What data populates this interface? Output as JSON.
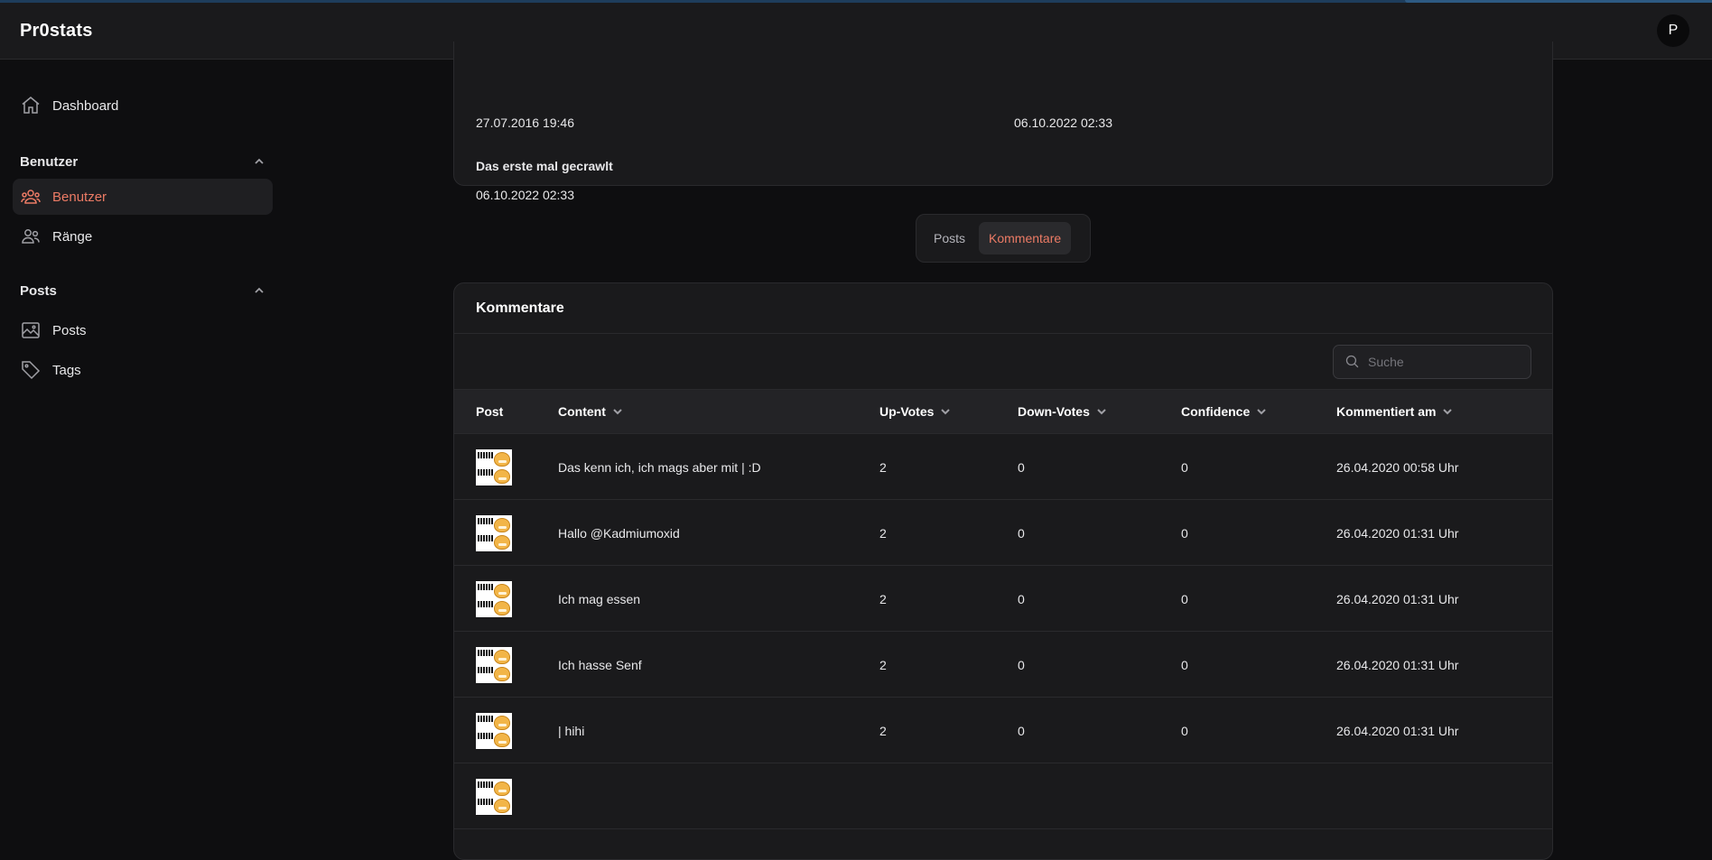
{
  "app": {
    "title": "Pr0stats",
    "user_initial": "P"
  },
  "sidebar": {
    "dashboard": "Dashboard",
    "sections": [
      {
        "title": "Benutzer",
        "items": [
          {
            "label": "Benutzer",
            "icon": "users-icon",
            "active": true
          },
          {
            "label": "Ränge",
            "icon": "user-group-icon",
            "active": false
          }
        ]
      },
      {
        "title": "Posts",
        "items": [
          {
            "label": "Posts",
            "icon": "image-icon",
            "active": false
          },
          {
            "label": "Tags",
            "icon": "tag-icon",
            "active": false
          }
        ]
      }
    ]
  },
  "info": {
    "value_left": "27.07.2016 19:46",
    "value_right": "06.10.2022 02:33",
    "crawled_label": "Das erste mal gecrawlt",
    "crawled_value": "06.10.2022 02:33"
  },
  "tabs": {
    "posts": "Posts",
    "comments": "Kommentare"
  },
  "comments": {
    "title": "Kommentare",
    "search_placeholder": "Suche",
    "columns": {
      "post": "Post",
      "content": "Content",
      "up": "Up-Votes",
      "down": "Down-Votes",
      "confidence": "Confidence",
      "date": "Kommentiert am"
    },
    "rows": [
      {
        "content": "Das kenn ich, ich mags aber mit | :D",
        "up": "2",
        "down": "0",
        "confidence": "0",
        "date": "26.04.2020 00:58 Uhr"
      },
      {
        "content": "Hallo @Kadmiumoxid",
        "up": "2",
        "down": "0",
        "confidence": "0",
        "date": "26.04.2020 01:31 Uhr"
      },
      {
        "content": "Ich mag essen",
        "up": "2",
        "down": "0",
        "confidence": "0",
        "date": "26.04.2020 01:31 Uhr"
      },
      {
        "content": "Ich hasse Senf",
        "up": "2",
        "down": "0",
        "confidence": "0",
        "date": "26.04.2020 01:31 Uhr"
      },
      {
        "content": "| hihi",
        "up": "2",
        "down": "0",
        "confidence": "0",
        "date": "26.04.2020 01:31 Uhr"
      }
    ]
  },
  "colors": {
    "accent": "#ec7b65",
    "background": "#0e0e10",
    "surface": "#1a1a1c",
    "border": "#2a2a2d"
  }
}
